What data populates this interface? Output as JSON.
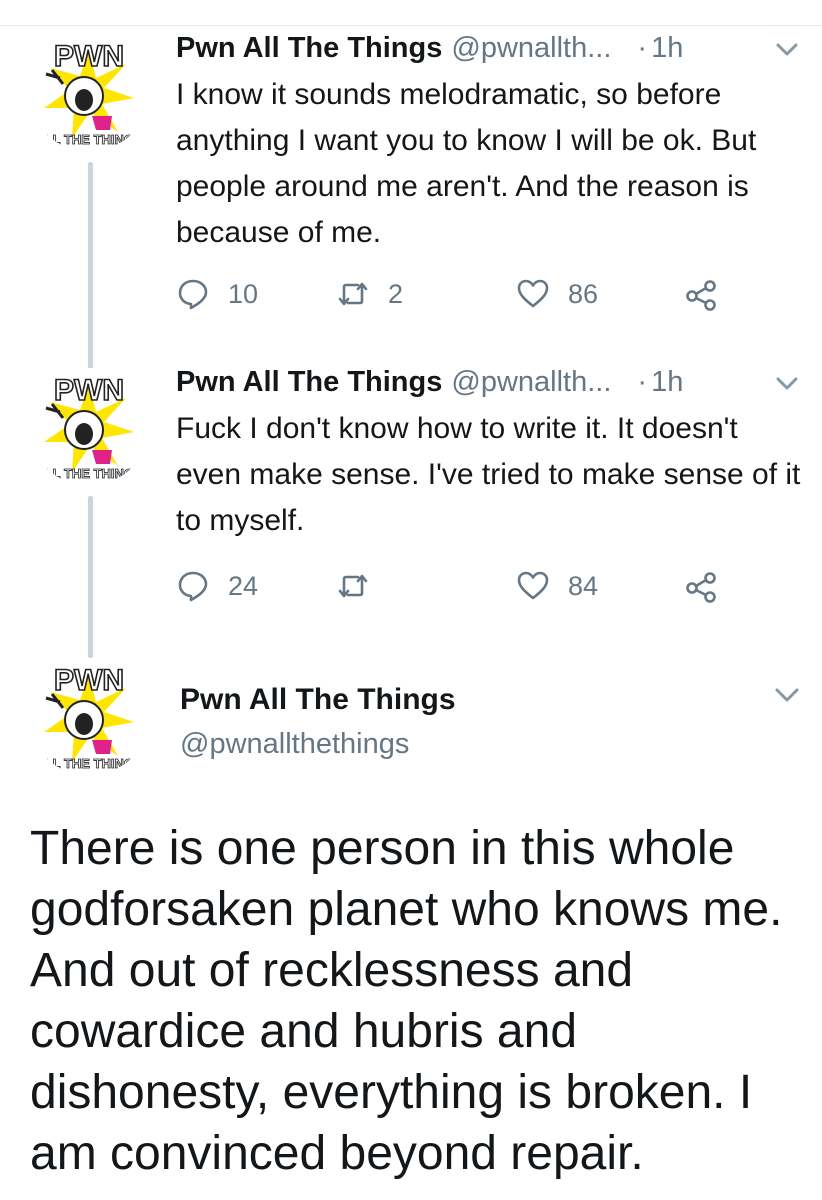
{
  "tweets": [
    {
      "author_name": "Pwn All The Things",
      "author_handle": "@pwnallth...",
      "separator": "·",
      "time": "1h",
      "text": "I know it sounds melodramatic, so before anything I want you to know I will be ok. But people around me aren't. And the reason is because of me.",
      "replies": "10",
      "retweets": "2",
      "likes": "86"
    },
    {
      "author_name": "Pwn All The Things",
      "author_handle": "@pwnallth...",
      "separator": "·",
      "time": "1h",
      "text": "Fuck I don't know how to write it. It doesn't even make sense. I've tried to make sense of it to myself.",
      "replies": "24",
      "retweets": "",
      "likes": "84"
    }
  ],
  "focused_tweet": {
    "author_name": "Pwn All The Things",
    "author_handle": "@pwnallthethings",
    "text": "There is one person in this whole godforsaken planet who knows me. And out of recklessness and cowardice and hubris and dishonesty, everything is broken. I am convinced beyond repair."
  },
  "avatar": {
    "top_text": "PWN",
    "bottom_text": "ALL THE THINGS",
    "background_color": "#ffe600",
    "text_color": "#ffffff"
  },
  "colors": {
    "text_primary": "#14171a",
    "text_secondary": "#657786",
    "thread_line": "#c9d6df",
    "icon": "#657786"
  },
  "icons": {
    "reply": "reply-icon",
    "retweet": "retweet-icon",
    "like": "heart-icon",
    "share": "share-icon",
    "menu": "chevron-down-icon"
  }
}
